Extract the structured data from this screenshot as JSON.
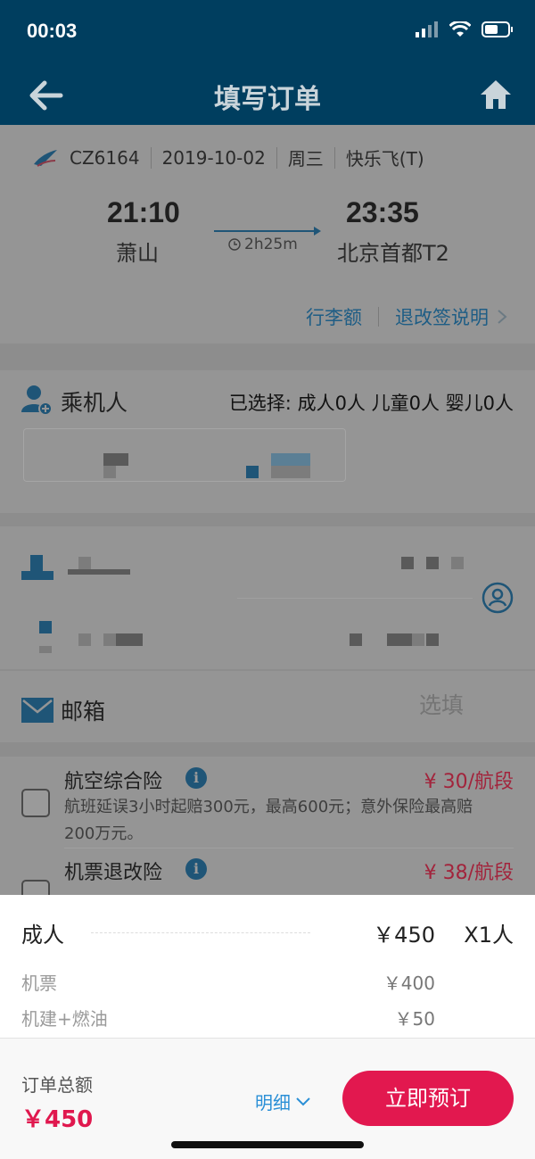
{
  "status_bar": {
    "time": "00:03"
  },
  "header": {
    "title": "填写订单"
  },
  "flight": {
    "number": "CZ6164",
    "date": "2019-10-02",
    "weekday": "周三",
    "fare_type": "快乐飞(T)",
    "depart_time": "21:10",
    "depart_city": "萧山",
    "arrive_time": "23:35",
    "arrive_city": "北京首都T2",
    "duration": "2h25m",
    "baggage_link": "行李额",
    "policy_link": "退改签说明"
  },
  "passengers": {
    "title": "乘机人",
    "selected": "已选择:  成人0人   儿童0人   婴儿0人"
  },
  "email": {
    "label": "邮箱",
    "placeholder": "选填"
  },
  "insurance": [
    {
      "title": "航空综合险",
      "price": "¥ 30/航段",
      "desc": "航班延误3小时起赔300元，最高600元；意外保险最高赔200万元。"
    },
    {
      "title": "机票退改险",
      "price": "¥ 38/航段"
    }
  ],
  "breakdown": {
    "adult_label": "成人",
    "adult_price": "￥450",
    "adult_count": "X1人",
    "ticket_label": "机票",
    "ticket_price": "￥400",
    "tax_label": "机建+燃油",
    "tax_price": "￥50"
  },
  "footer": {
    "total_label": "订单总额",
    "total_value": "￥450",
    "detail_label": "明细",
    "book_label": "立即预订"
  },
  "colors": {
    "header": "#003e5f",
    "accent": "#e2184f",
    "link": "#2a8fd6"
  }
}
